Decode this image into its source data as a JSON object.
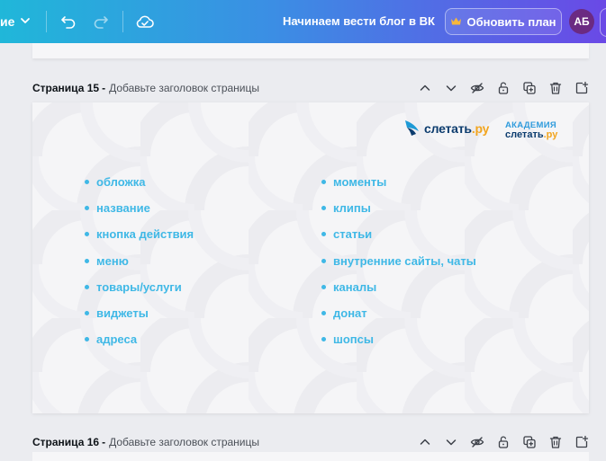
{
  "topbar": {
    "menu_label": "ие",
    "title": "Начинаем вести блог в ВК",
    "upgrade_label": "Обновить план",
    "avatar_initials": "АБ",
    "gradient": [
      "#20b7d9",
      "#3b8ee4",
      "#6a49e6"
    ]
  },
  "pages": [
    {
      "name": "Страница 15",
      "separator": "-",
      "subtitle": "Добавьте заголовок страницы"
    },
    {
      "name": "Страница 16",
      "separator": "-",
      "subtitle": "Добавьте заголовок страницы"
    }
  ],
  "slide": {
    "logo1": {
      "main": "слетать",
      "suffix": ".ру"
    },
    "logo2": {
      "line1": "АКАДЕМИЯ",
      "line2_main": "слетать",
      "line2_suffix": ".ру"
    },
    "left_items": [
      "обложка",
      "название",
      "кнопка действия",
      "меню",
      "товары/услуги",
      "виджеты",
      "адреса"
    ],
    "right_items": [
      "моменты",
      "клипы",
      "статьи",
      "внутренние сайты, чаты",
      "каналы",
      "донат",
      "шопсы"
    ],
    "accent_color": "#3fb8e6"
  }
}
